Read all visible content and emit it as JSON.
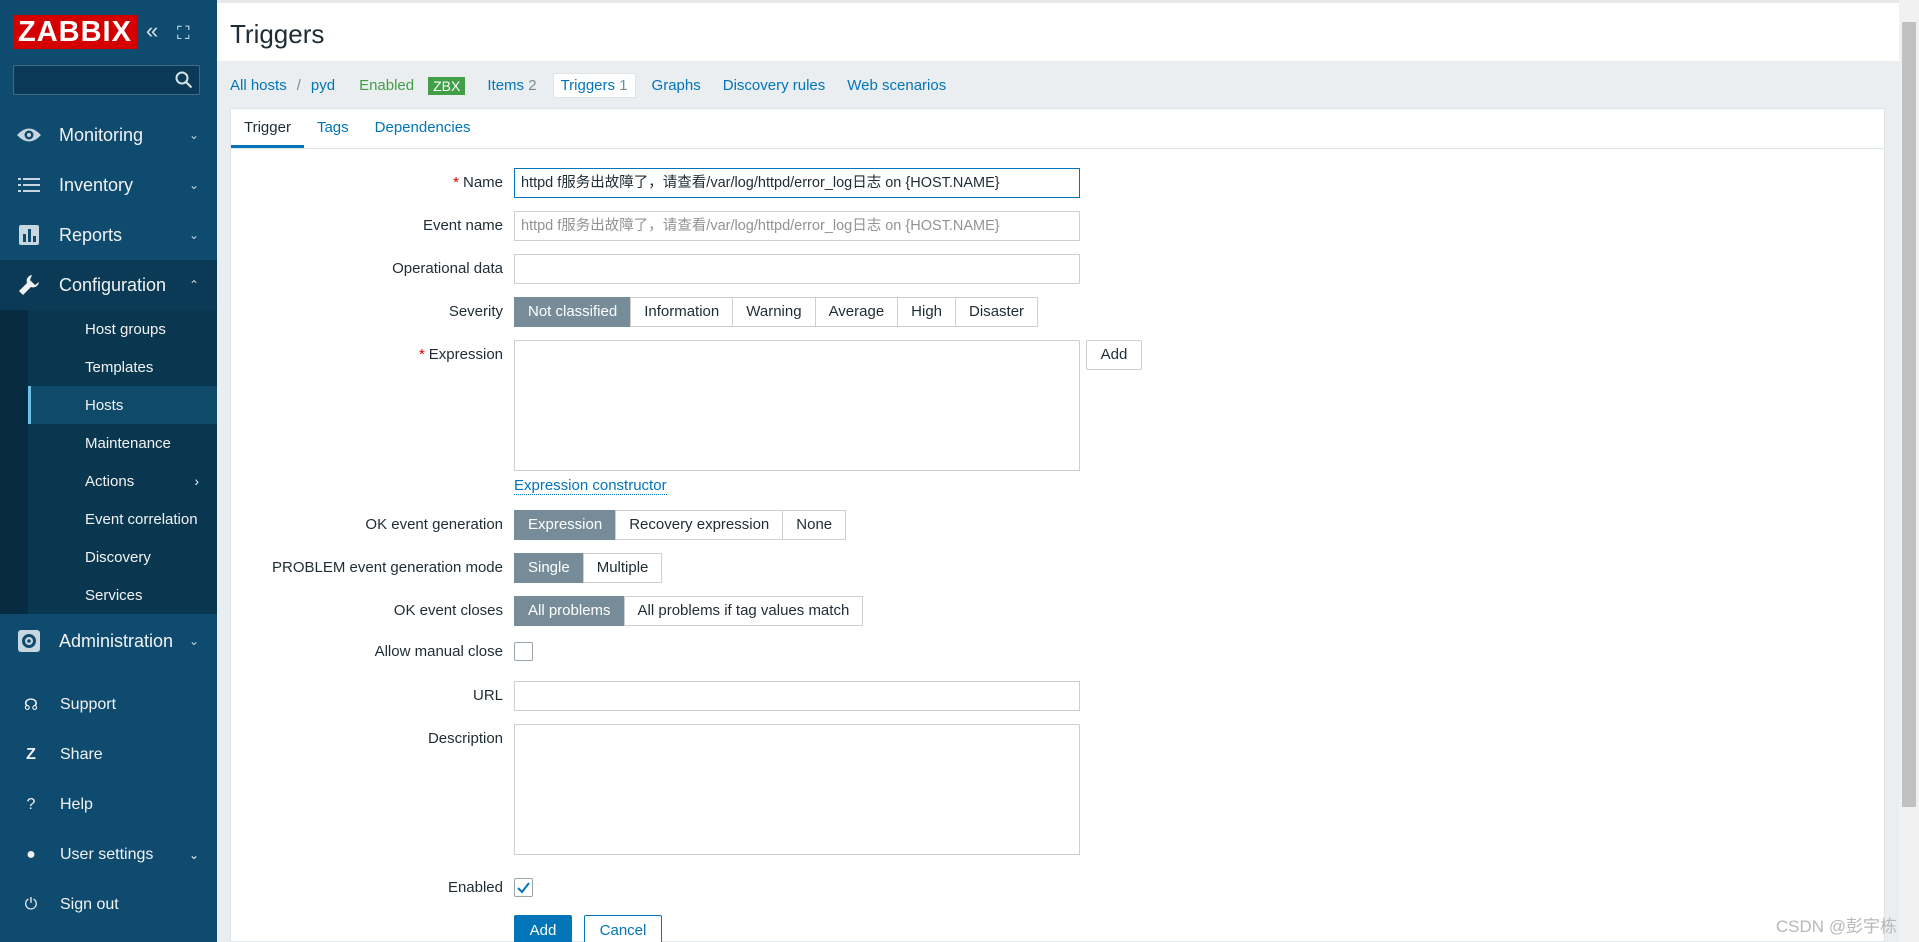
{
  "sidebar": {
    "logo": "ZABBIX",
    "collapse_icon": "«",
    "kiosk_icon": "⛶",
    "menu": [
      {
        "label": "Monitoring",
        "icon": "eye-icon"
      },
      {
        "label": "Inventory",
        "icon": "list-icon"
      },
      {
        "label": "Reports",
        "icon": "chart-icon"
      },
      {
        "label": "Configuration",
        "icon": "wrench-icon"
      }
    ],
    "config_submenu": [
      {
        "label": "Host groups"
      },
      {
        "label": "Templates"
      },
      {
        "label": "Hosts"
      },
      {
        "label": "Maintenance"
      },
      {
        "label": "Actions"
      },
      {
        "label": "Event correlation"
      },
      {
        "label": "Discovery"
      },
      {
        "label": "Services"
      }
    ],
    "administration": "Administration",
    "bottom": [
      {
        "label": "Support",
        "icon": "headset-icon",
        "glyph": "☊"
      },
      {
        "label": "Share",
        "icon": "share-icon",
        "glyph": "Z"
      },
      {
        "label": "Help",
        "icon": "help-icon",
        "glyph": "?"
      },
      {
        "label": "User settings",
        "icon": "user-icon",
        "glyph": "●"
      },
      {
        "label": "Sign out",
        "icon": "power-icon",
        "glyph": "⏻"
      }
    ]
  },
  "header": {
    "title": "Triggers"
  },
  "breadcrumb": {
    "all_hosts": "All hosts",
    "sep": "/",
    "host": "pyd",
    "status": "Enabled",
    "zbx": "ZBX",
    "items": "Items",
    "items_count": "2",
    "triggers": "Triggers",
    "triggers_count": "1",
    "graphs": "Graphs",
    "discovery": "Discovery rules",
    "web": "Web scenarios"
  },
  "tabs": [
    "Trigger",
    "Tags",
    "Dependencies"
  ],
  "form": {
    "name_label": "Name",
    "name_value": "httpd f服务出故障了，请查看/var/log/httpd/error_log日志 on {HOST.NAME}",
    "event_name_label": "Event name",
    "event_name_placeholder": "httpd f服务出故障了，请查看/var/log/httpd/error_log日志 on {HOST.NAME}",
    "opdata_label": "Operational data",
    "severity_label": "Severity",
    "severity_options": [
      "Not classified",
      "Information",
      "Warning",
      "Average",
      "High",
      "Disaster"
    ],
    "expression_label": "Expression",
    "add_label": "Add",
    "expression_constructor": "Expression constructor",
    "ok_event_generation_label": "OK event generation",
    "ok_event_generation_options": [
      "Expression",
      "Recovery expression",
      "None"
    ],
    "problem_mode_label": "PROBLEM event generation mode",
    "problem_mode_options": [
      "Single",
      "Multiple"
    ],
    "ok_closes_label": "OK event closes",
    "ok_closes_options": [
      "All problems",
      "All problems if tag values match"
    ],
    "manual_close_label": "Allow manual close",
    "url_label": "URL",
    "description_label": "Description",
    "enabled_label": "Enabled",
    "submit_label": "Add",
    "cancel_label": "Cancel"
  },
  "watermark": "CSDN @彭宇栋",
  "colors": {
    "sidebar": "#0e4b6e",
    "accent": "#0275b8",
    "logo": "#d40000",
    "enabled": "#429e47"
  }
}
